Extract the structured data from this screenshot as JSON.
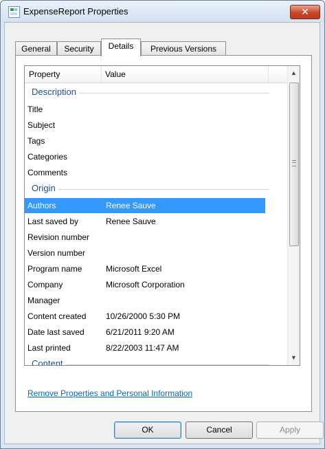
{
  "window": {
    "title": "ExpenseReport Properties",
    "close_glyph": "✕"
  },
  "tabs": [
    {
      "label": "General"
    },
    {
      "label": "Security"
    },
    {
      "label": "Details"
    },
    {
      "label": "Previous Versions"
    }
  ],
  "active_tab": "Details",
  "list": {
    "header": {
      "property": "Property",
      "value": "Value"
    },
    "groups": {
      "description": "Description",
      "origin": "Origin",
      "content": "Content"
    },
    "description_rows": [
      {
        "property": "Title",
        "value": ""
      },
      {
        "property": "Subject",
        "value": ""
      },
      {
        "property": "Tags",
        "value": ""
      },
      {
        "property": "Categories",
        "value": ""
      },
      {
        "property": "Comments",
        "value": ""
      }
    ],
    "origin_rows": [
      {
        "property": "Authors",
        "value": "Renee Sauve"
      },
      {
        "property": "Last saved by",
        "value": "Renee Sauve"
      },
      {
        "property": "Revision number",
        "value": ""
      },
      {
        "property": "Version number",
        "value": ""
      },
      {
        "property": "Program name",
        "value": "Microsoft Excel"
      },
      {
        "property": "Company",
        "value": "Microsoft Corporation"
      },
      {
        "property": "Manager",
        "value": ""
      },
      {
        "property": "Content created",
        "value": "10/26/2000 5:30 PM"
      },
      {
        "property": "Date last saved",
        "value": "6/21/2011 9:20 AM"
      },
      {
        "property": "Last printed",
        "value": "8/22/2003 11:47 AM"
      }
    ],
    "selected_row": "Authors"
  },
  "link": {
    "remove_properties": "Remove Properties and Personal Information"
  },
  "buttons": {
    "ok": "OK",
    "cancel": "Cancel",
    "apply": "Apply"
  },
  "colors": {
    "selection": "#3399ff",
    "group_heading": "#1e4e9a",
    "link": "#0066cc",
    "close_button": "#c8472b"
  }
}
